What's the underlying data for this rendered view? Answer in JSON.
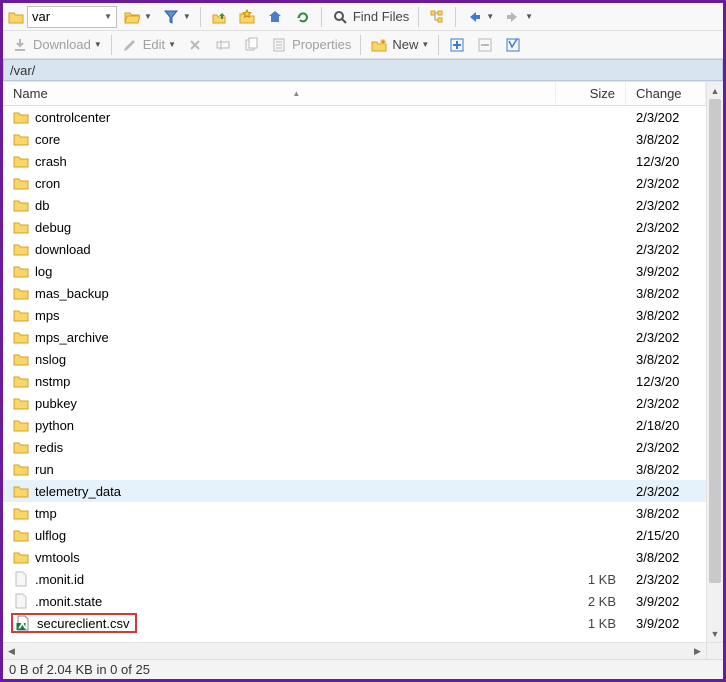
{
  "toolbar1": {
    "combo_value": "var",
    "find_files_label": "Find Files"
  },
  "toolbar2": {
    "download_label": "Download",
    "edit_label": "Edit",
    "properties_label": "Properties",
    "new_label": "New"
  },
  "path": "/var/",
  "columns": {
    "name": "Name",
    "size": "Size",
    "changed": "Change"
  },
  "rows": [
    {
      "kind": "folder",
      "name": "controlcenter",
      "size": "",
      "changed": "2/3/202",
      "selected": false
    },
    {
      "kind": "folder",
      "name": "core",
      "size": "",
      "changed": "3/8/202",
      "selected": false
    },
    {
      "kind": "folder",
      "name": "crash",
      "size": "",
      "changed": "12/3/20",
      "selected": false
    },
    {
      "kind": "folder",
      "name": "cron",
      "size": "",
      "changed": "2/3/202",
      "selected": false
    },
    {
      "kind": "folder",
      "name": "db",
      "size": "",
      "changed": "2/3/202",
      "selected": false
    },
    {
      "kind": "folder",
      "name": "debug",
      "size": "",
      "changed": "2/3/202",
      "selected": false
    },
    {
      "kind": "folder",
      "name": "download",
      "size": "",
      "changed": "2/3/202",
      "selected": false
    },
    {
      "kind": "folder",
      "name": "log",
      "size": "",
      "changed": "3/9/202",
      "selected": false
    },
    {
      "kind": "folder",
      "name": "mas_backup",
      "size": "",
      "changed": "3/8/202",
      "selected": false
    },
    {
      "kind": "folder",
      "name": "mps",
      "size": "",
      "changed": "3/8/202",
      "selected": false
    },
    {
      "kind": "folder",
      "name": "mps_archive",
      "size": "",
      "changed": "2/3/202",
      "selected": false
    },
    {
      "kind": "folder",
      "name": "nslog",
      "size": "",
      "changed": "3/8/202",
      "selected": false
    },
    {
      "kind": "folder",
      "name": "nstmp",
      "size": "",
      "changed": "12/3/20",
      "selected": false
    },
    {
      "kind": "folder",
      "name": "pubkey",
      "size": "",
      "changed": "2/3/202",
      "selected": false
    },
    {
      "kind": "folder",
      "name": "python",
      "size": "",
      "changed": "2/18/20",
      "selected": false
    },
    {
      "kind": "folder",
      "name": "redis",
      "size": "",
      "changed": "2/3/202",
      "selected": false
    },
    {
      "kind": "folder",
      "name": "run",
      "size": "",
      "changed": "3/8/202",
      "selected": false
    },
    {
      "kind": "folder",
      "name": "telemetry_data",
      "size": "",
      "changed": "2/3/202",
      "selected": true
    },
    {
      "kind": "folder",
      "name": "tmp",
      "size": "",
      "changed": "3/8/202",
      "selected": false
    },
    {
      "kind": "folder",
      "name": "ulflog",
      "size": "",
      "changed": "2/15/20",
      "selected": false
    },
    {
      "kind": "folder",
      "name": "vmtools",
      "size": "",
      "changed": "3/8/202",
      "selected": false
    },
    {
      "kind": "file",
      "name": ".monit.id",
      "size": "1 KB",
      "changed": "2/3/202",
      "selected": false
    },
    {
      "kind": "file",
      "name": ".monit.state",
      "size": "2 KB",
      "changed": "3/9/202",
      "selected": false
    },
    {
      "kind": "csv",
      "name": "secureclient.csv",
      "size": "1 KB",
      "changed": "3/9/202",
      "selected": false,
      "highlighted": true
    }
  ],
  "status": "0 B of 2.04 KB in 0 of 25"
}
